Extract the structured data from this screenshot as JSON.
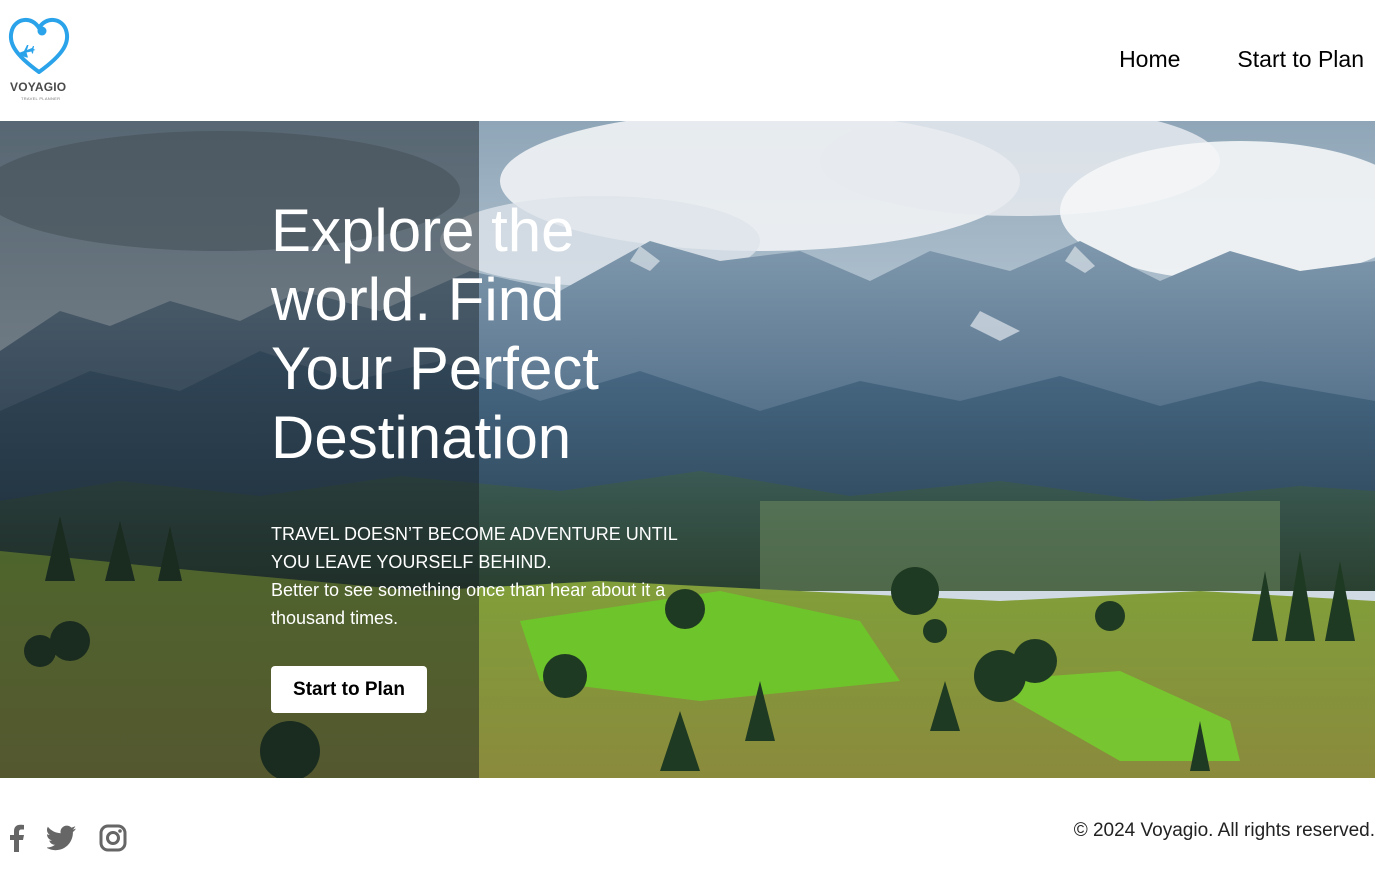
{
  "brand": {
    "name": "VOYAGIO",
    "tagline": "TRAVEL PLANNER",
    "accent_color": "#2aa3ea"
  },
  "nav": {
    "items": [
      {
        "label": "Home"
      },
      {
        "label": "Start to Plan"
      }
    ]
  },
  "hero": {
    "title": "Explore the world. Find Your Perfect Destination",
    "subtitle": "TRAVEL DOESN’T BECOME ADVENTURE UNTIL YOU LEAVE YOURSELF BEHIND.",
    "text": "Better to see something once than hear about it a thousand times.",
    "cta_label": "Start to Plan"
  },
  "footer": {
    "social": [
      {
        "icon": "facebook-icon"
      },
      {
        "icon": "twitter-icon"
      },
      {
        "icon": "instagram-icon"
      }
    ],
    "copyright": "© 2024 Voyagio. All rights reserved."
  }
}
